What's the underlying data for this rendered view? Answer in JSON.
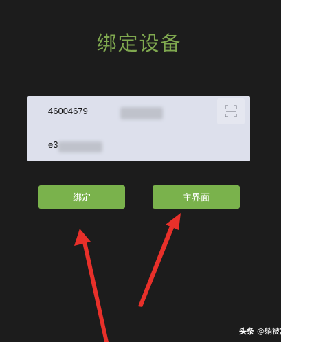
{
  "title": "绑定设备",
  "form": {
    "device_id_value": "46004679",
    "second_value": "e3"
  },
  "buttons": {
    "bind_label": "绑定",
    "main_label": "主界面"
  },
  "icons": {
    "scan": "scan-icon"
  },
  "watermark": {
    "brand": "头条",
    "handle": "@躺被窝看电影"
  },
  "colors": {
    "accent": "#7ab24c",
    "title": "#7fa84f",
    "background": "#1c1c1c",
    "annotation_arrow": "#e8302a"
  }
}
